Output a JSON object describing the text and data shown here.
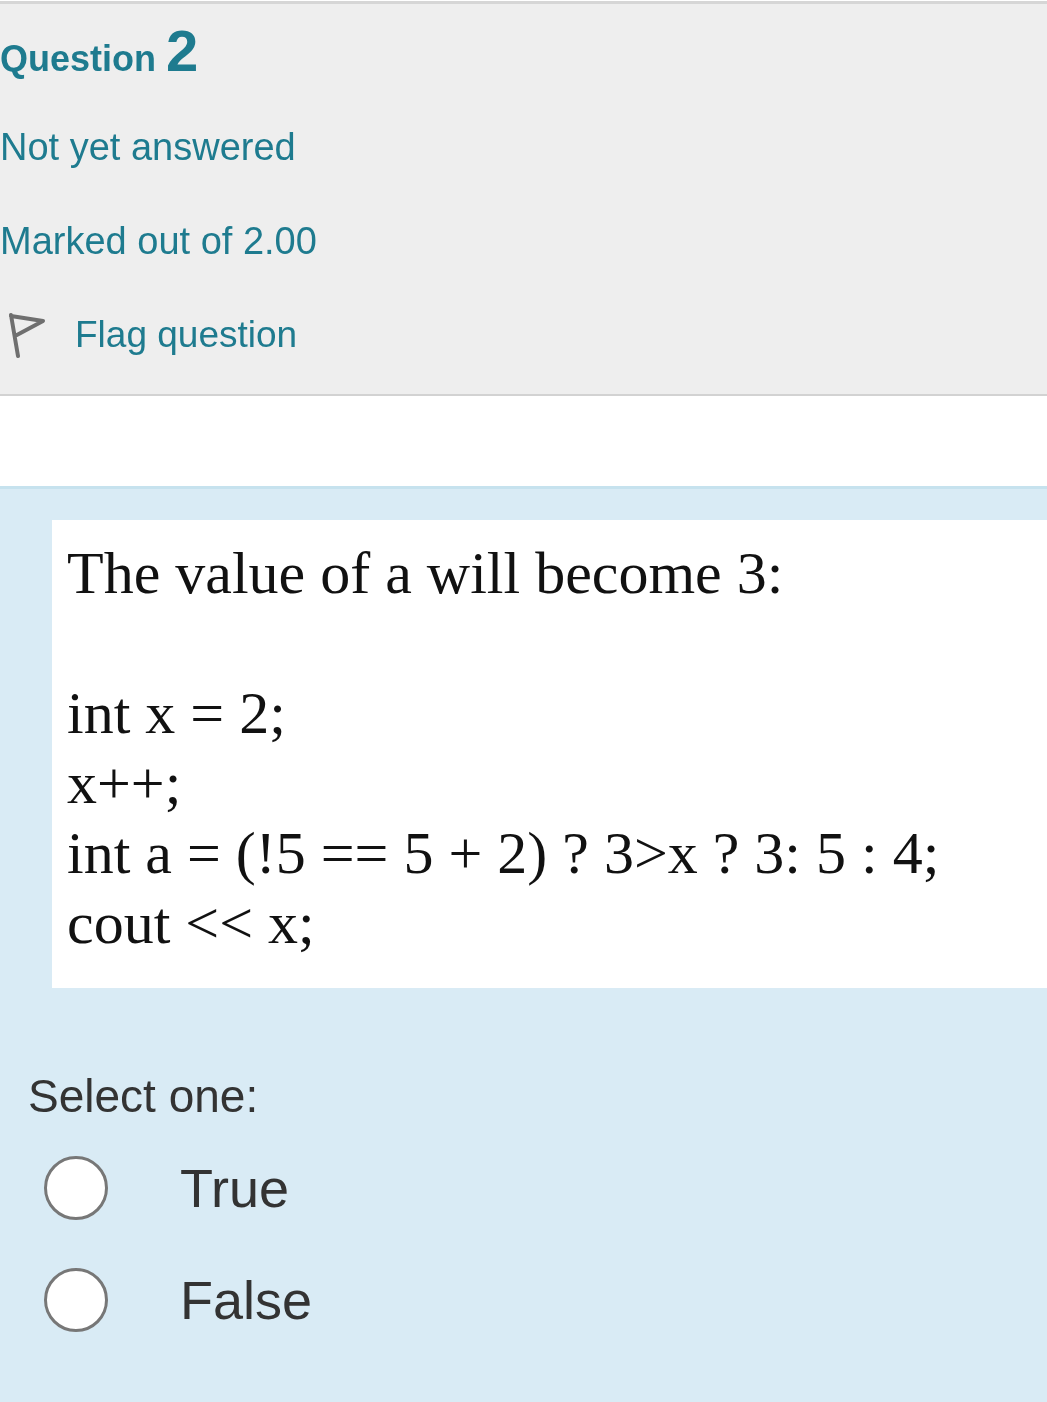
{
  "question": {
    "label": "Question",
    "number": "2",
    "status": "Not yet answered",
    "marks": "Marked out of 2.00",
    "flag_label": "Flag question"
  },
  "question_text": {
    "title": "The value of a will become 3:",
    "code_lines": [
      "int x = 2;",
      "x++;",
      "int a = (!5 == 5 + 2) ? 3>x ? 3: 5 : 4;",
      "cout << x;"
    ]
  },
  "prompt": "Select one:",
  "options": [
    {
      "label": "True",
      "selected": false
    },
    {
      "label": "False",
      "selected": false
    }
  ]
}
